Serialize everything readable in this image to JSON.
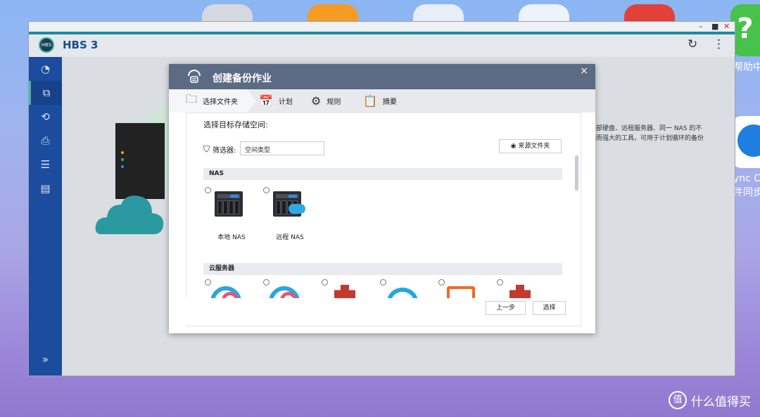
{
  "desktop": {
    "side_apps": [
      {
        "label": "帮助中",
        "icon": "help-icon"
      },
      {
        "label": "ync C\n件同步",
        "icon": "sync-icon"
      }
    ],
    "watermark": "什么值得买",
    "watermark_logo": "值"
  },
  "window": {
    "controls": {
      "minimize": "–",
      "maximize": "■",
      "close": "✕"
    },
    "app_logo": "HBS",
    "app_title": "HBS 3",
    "refresh_icon": "↻",
    "more_icon": "⋮",
    "sidebar": {
      "items": [
        {
          "icon": "dashboard-icon",
          "glyph": "◔"
        },
        {
          "icon": "backup-icon",
          "glyph": "⧉",
          "active": true
        },
        {
          "icon": "sync-icon",
          "glyph": "⟲"
        },
        {
          "icon": "restore-icon",
          "glyph": "⎙"
        },
        {
          "icon": "storage-icon",
          "glyph": "☰"
        },
        {
          "icon": "logs-icon",
          "glyph": "▤"
        }
      ],
      "expand": "»"
    },
    "background_text": "外部硬盘、远程服务器、同一 NAS 的不\n间而强大的工具，可用于计划循环的备份"
  },
  "modal": {
    "title": "创建备份作业",
    "close": "×",
    "steps": [
      {
        "label": "选择文件夹",
        "icon": "folder-icon",
        "glyph": "🗀"
      },
      {
        "label": "计划",
        "icon": "calendar-icon",
        "glyph": "📅"
      },
      {
        "label": "规则",
        "icon": "rules-icon",
        "glyph": "⚙"
      },
      {
        "label": "摘要",
        "icon": "summary-icon",
        "glyph": "📋"
      }
    ],
    "section_title": "选择目标存储空间:",
    "filter_label": "筛选器:",
    "filter_value": "空间类型",
    "source_folder_button": "来源文件夹",
    "groups": {
      "nas": {
        "title": "NAS",
        "items": [
          {
            "label": "本地 NAS",
            "icon": "local-nas-icon"
          },
          {
            "label": "远程 NAS",
            "icon": "remote-nas-icon"
          }
        ]
      },
      "cloud": {
        "title": "云服务器",
        "items": [
          {
            "icon": "cloud-service-1-icon"
          },
          {
            "icon": "cloud-service-2-icon"
          },
          {
            "icon": "aws-s3-icon"
          },
          {
            "icon": "cloud-service-4-icon"
          },
          {
            "icon": "bracket-service-icon"
          },
          {
            "icon": "aws-glacier-icon"
          }
        ]
      }
    },
    "buttons": {
      "prev": "上一步",
      "select": "选择"
    }
  }
}
